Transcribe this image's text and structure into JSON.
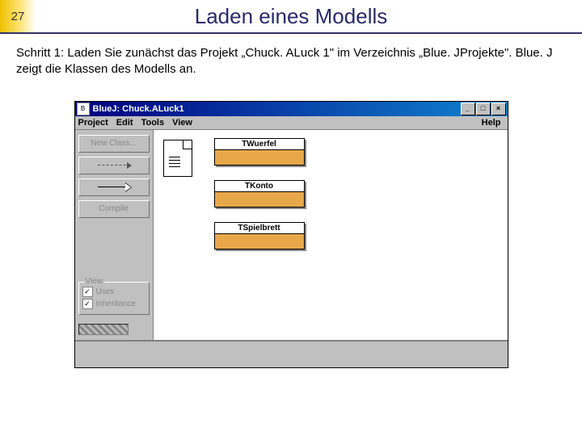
{
  "slide": {
    "number": "27",
    "title": "Laden eines Modells",
    "body": "Schritt 1: Laden Sie zunächst das Projekt „Chuck. ALuck 1\" im Verzeichnis „Blue. JProjekte\". Blue. J zeigt die Klassen des Modells an."
  },
  "bluej": {
    "title": "BlueJ:   Chuck.ALuck1",
    "menu": {
      "project": "Project",
      "edit": "Edit",
      "tools": "Tools",
      "view": "View",
      "help": "Help"
    },
    "side": {
      "newclass": "New Class...",
      "compile": "Compile",
      "legend_title": "View",
      "uses": "Uses",
      "inheritance": "Inheritance"
    },
    "classes": {
      "c1": "TWuerfel",
      "c2": "TKonto",
      "c3": "TSpielbrett"
    }
  }
}
